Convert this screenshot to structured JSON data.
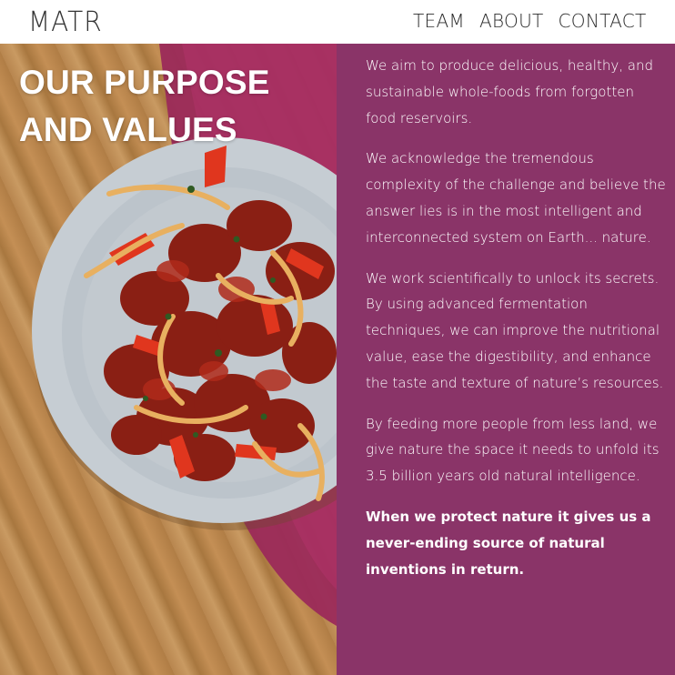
{
  "brand": {
    "logo": "MATR"
  },
  "nav": {
    "items": [
      "TEAM",
      "ABOUT",
      "CONTACT"
    ]
  },
  "hero": {
    "title_line1": "OUR PURPOSE",
    "title_line2": "AND VALUES"
  },
  "content": {
    "paragraphs": [
      "We aim to produce delicious, healthy, and sustainable whole-foods from forgotten food reservoirs.",
      "We acknowledge the tremendous complexity of the challenge and believe the answer lies is in the most intelligent and interconnected system on Earth... nature.",
      "We work scientifically to unlock its secrets. By using advanced fermentation techniques, we can improve the nutritional value, ease the digestibility, and enhance  the taste and texture of nature’s resources.",
      "By feeding more people from less land, we give nature the space it needs to unfold its 3.5 billion years old natural intelligence."
    ],
    "closing": "When we protect nature it gives us a never-ending source of natural inventions in return."
  },
  "colors": {
    "panel": "#8a3468",
    "nav_text": "#2a2a2a",
    "wood": "#b8864f",
    "plate": "#c9d0d6",
    "placemat": "#a0285a"
  }
}
